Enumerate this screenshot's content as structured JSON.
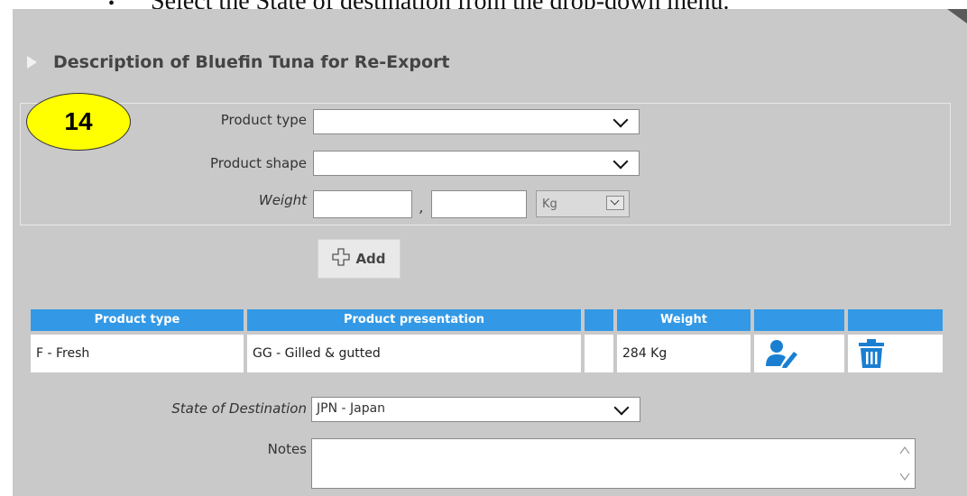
{
  "doc_text": "Select the State of destination from the drop-down menu.",
  "section": {
    "title": "Description of Bluefin Tuna for Re-Export"
  },
  "badge": "14",
  "form": {
    "product_type_label": "Product type",
    "product_type_value": "",
    "product_shape_label": "Product shape",
    "product_shape_value": "",
    "weight_label": "Weight",
    "weight_int": "",
    "weight_comma": ",",
    "weight_dec": "",
    "unit_value": "Kg"
  },
  "add_button": {
    "label": "Add",
    "icon": "plus-icon"
  },
  "table": {
    "headers": [
      "Product type",
      "Product presentation",
      "",
      "Weight",
      "",
      ""
    ],
    "rows": [
      {
        "product_type": "F - Fresh",
        "presentation": "GG - Gilled & gutted",
        "extra": "",
        "weight": "284 Kg",
        "edit_icon": "edit-user-icon",
        "delete_icon": "trash-icon"
      }
    ]
  },
  "destination": {
    "label": "State of Destination",
    "value": "JPN - Japan"
  },
  "notes": {
    "label": "Notes",
    "value": ""
  },
  "colors": {
    "header_blue": "#3399e6",
    "panel_gray": "#c9c9c9",
    "badge_yellow": "#ffff00",
    "icon_blue": "#1a7fd1"
  }
}
